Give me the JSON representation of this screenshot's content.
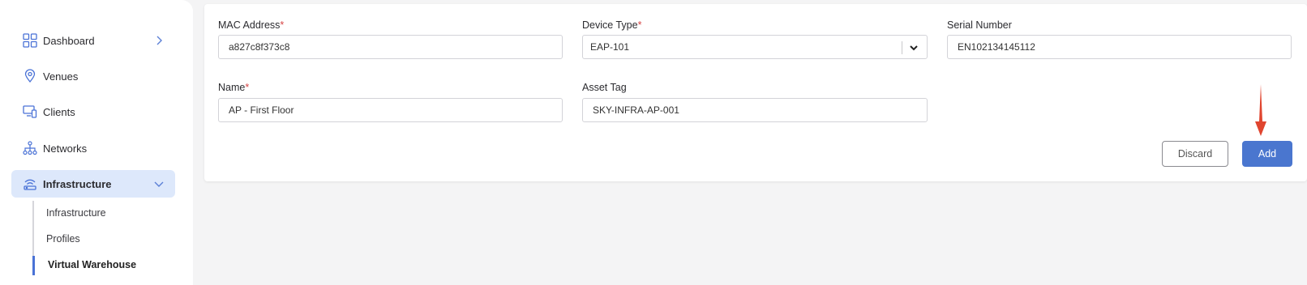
{
  "sidebar": {
    "items": [
      {
        "label": "Dashboard",
        "icon": "dashboard-grid-icon"
      },
      {
        "label": "Venues",
        "icon": "location-pin-icon"
      },
      {
        "label": "Clients",
        "icon": "devices-icon"
      },
      {
        "label": "Networks",
        "icon": "network-tree-icon"
      },
      {
        "label": "Infrastructure",
        "icon": "access-point-icon"
      }
    ],
    "sub_items": [
      "Infrastructure",
      "Profiles",
      "Virtual Warehouse"
    ]
  },
  "form": {
    "mac": {
      "label": "MAC Address",
      "required_mark": "*",
      "value": "a827c8f373c8"
    },
    "device_type": {
      "label": "Device Type",
      "required_mark": "*",
      "value": "EAP-101"
    },
    "serial": {
      "label": "Serial Number",
      "value": "EN102134145112"
    },
    "name": {
      "label": "Name",
      "required_mark": "*",
      "value": "AP - First Floor"
    },
    "asset_tag": {
      "label": "Asset Tag",
      "value": "SKY-INFRA-AP-001"
    }
  },
  "buttons": {
    "discard": "Discard",
    "add": "Add"
  },
  "colors": {
    "accent": "#4a76cf",
    "active_bg": "#dde8fb",
    "required": "#d64545",
    "annotation_arrow": "#e0452f"
  }
}
